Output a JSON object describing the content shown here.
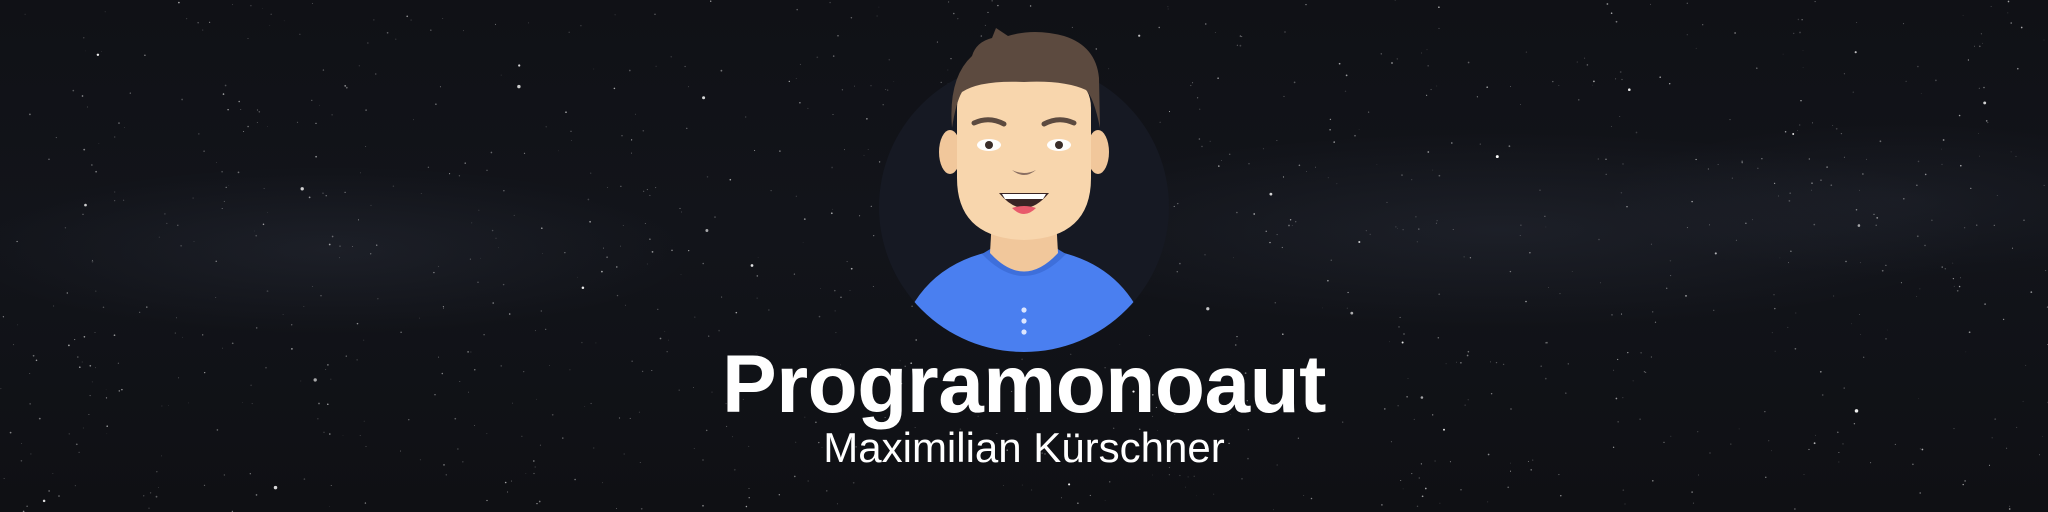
{
  "banner": {
    "title": "Programonoaut",
    "subtitle": "Maximilian Kürschner"
  },
  "avatar": {
    "icon": "person-avatar-icon"
  },
  "colors": {
    "background": "#0e0f13",
    "text": "#ffffff",
    "avatar_circle": "#161923",
    "shirt": "#4a7ff0",
    "skin": "#f8d6ad",
    "hair": "#5c4a3f"
  }
}
